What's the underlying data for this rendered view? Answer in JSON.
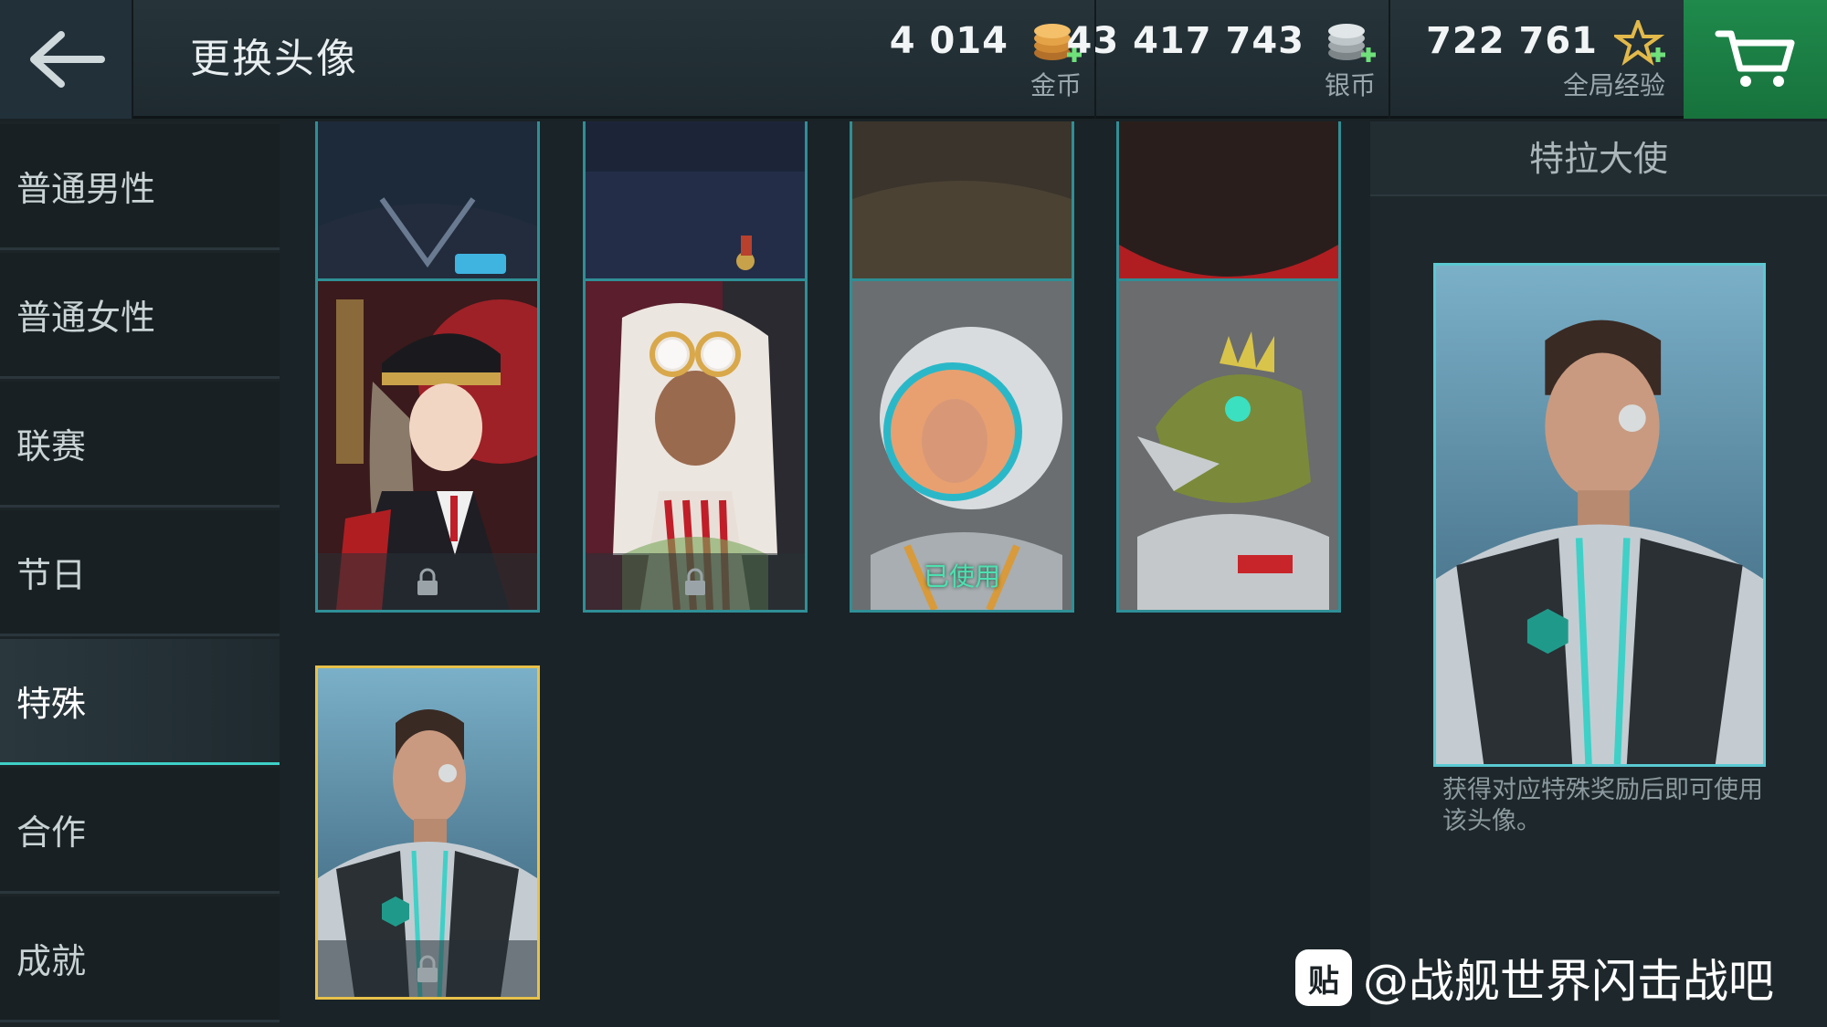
{
  "header": {
    "title": "更换头像",
    "back_icon": "arrow-left-icon",
    "currencies": [
      {
        "value": "4 014",
        "label": "金币",
        "icon": "gold-coins-icon"
      },
      {
        "value": "43 417 743",
        "label": "银币",
        "icon": "silver-coins-icon"
      },
      {
        "value": "722 761",
        "label": "全局经验",
        "icon": "xp-star-icon"
      }
    ],
    "cart_icon": "cart-icon"
  },
  "sidebar": {
    "items": [
      {
        "label": "普通男性",
        "active": false
      },
      {
        "label": "普通女性",
        "active": false
      },
      {
        "label": "联赛",
        "active": false
      },
      {
        "label": "节日",
        "active": false
      },
      {
        "label": "特殊",
        "active": true
      },
      {
        "label": "合作",
        "active": false
      },
      {
        "label": "成就",
        "active": false
      }
    ]
  },
  "avatars": [
    {
      "name": "avatar-officer-dark",
      "locked": true
    },
    {
      "name": "avatar-medal-officer",
      "locked": true
    },
    {
      "name": "avatar-binoculars-officer",
      "locked": true
    },
    {
      "name": "avatar-red-scarf-officer",
      "locked": true
    },
    {
      "name": "avatar-anime-captain",
      "locked": true
    },
    {
      "name": "avatar-anime-goggles-girl",
      "locked": true
    },
    {
      "name": "avatar-astronaut",
      "locked": false,
      "status": "已使用"
    },
    {
      "name": "avatar-lizard-pilot",
      "locked": false
    },
    {
      "name": "avatar-tral-ambassador",
      "locked": true,
      "selected": true
    }
  ],
  "panel": {
    "title": "特拉大使",
    "description": "获得对应特殊奖励后即可使用该头像。"
  },
  "watermark": {
    "logo": "贴",
    "text": "@战舰世界闪击战吧"
  },
  "colors": {
    "accent": "#3fd0c7",
    "card_border": "#2f8f96",
    "selected_border": "#e7c14a",
    "cart_green": "#1f8a4c",
    "used_text": "#4ee0b0"
  }
}
